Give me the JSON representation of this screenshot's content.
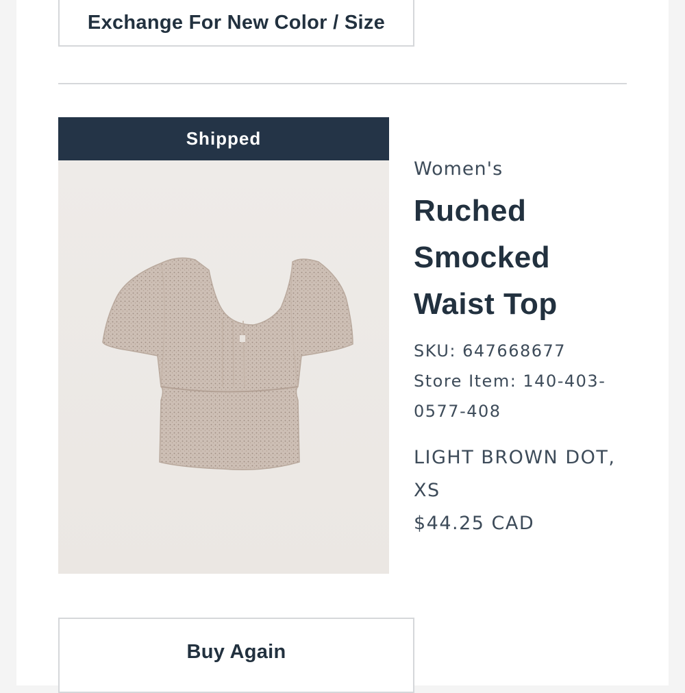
{
  "actions": {
    "exchange_label": "Exchange For New Color / Size",
    "buy_again_label": "Buy Again"
  },
  "item": {
    "status": "Shipped",
    "department": "Women's",
    "name_lines": [
      "Ruched",
      "Smocked",
      "Waist Top"
    ],
    "sku": "SKU: 647668677",
    "store_item_line1": "Store Item: 140-403-",
    "store_item_line2": "0577-408",
    "variant_line1": "LIGHT BROWN DOT,",
    "variant_line2": "XS",
    "price": "$44.25 CAD",
    "image_icon": "product-photo-crop-top"
  },
  "colors": {
    "status_bar": "#243447",
    "text_primary": "#22313f",
    "border": "#d5d7da"
  }
}
